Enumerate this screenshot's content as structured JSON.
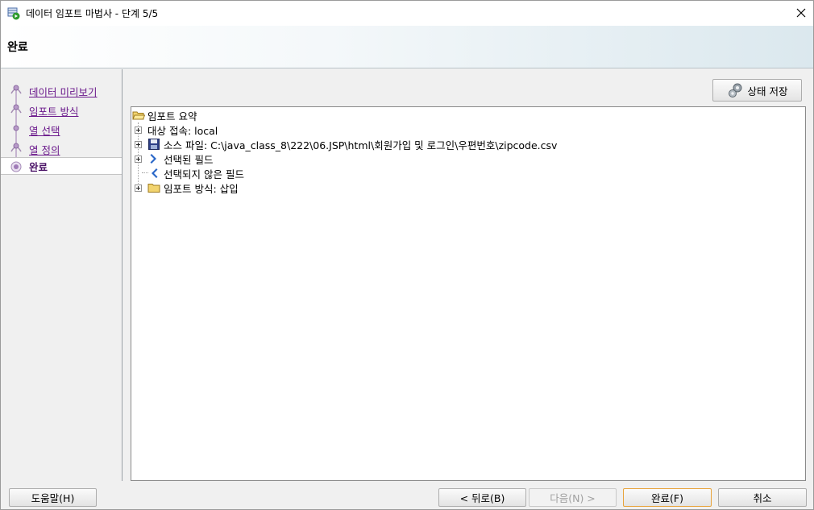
{
  "window": {
    "title": "데이터 임포트 마법사 - 단계 5/5"
  },
  "header": {
    "title": "완료"
  },
  "steps": [
    {
      "label": "데이터 미리보기",
      "active": false
    },
    {
      "label": "임포트 방식",
      "active": false
    },
    {
      "label": "열 선택",
      "active": false
    },
    {
      "label": "열 정의",
      "active": false
    },
    {
      "label": "완료",
      "active": true
    }
  ],
  "toolbar": {
    "save_state_label": "상태 저장"
  },
  "tree": {
    "root": "임포트 요약",
    "nodes": [
      {
        "label": "대상 접속: local",
        "icon": "none"
      },
      {
        "label": "소스 파일: C:\\java_class_8\\222\\06.JSP\\html\\회원가입 및 로그인\\우편번호\\zipcode.csv",
        "icon": "save-disk-icon"
      },
      {
        "label": "선택된 필드",
        "icon": "chevron-right-icon"
      },
      {
        "label": "선택되지 않은 필드",
        "icon": "chevron-left-icon"
      },
      {
        "label": "임포트 방식: 삽입",
        "icon": "folder-icon"
      }
    ]
  },
  "buttons": {
    "help": "도움말(H)",
    "back": "< 뒤로(B)",
    "next": "다음(N) >",
    "finish": "완료(F)",
    "cancel": "취소"
  },
  "colors": {
    "step_link": "#6b1a8c",
    "default_button_border": "#e8a33a"
  }
}
